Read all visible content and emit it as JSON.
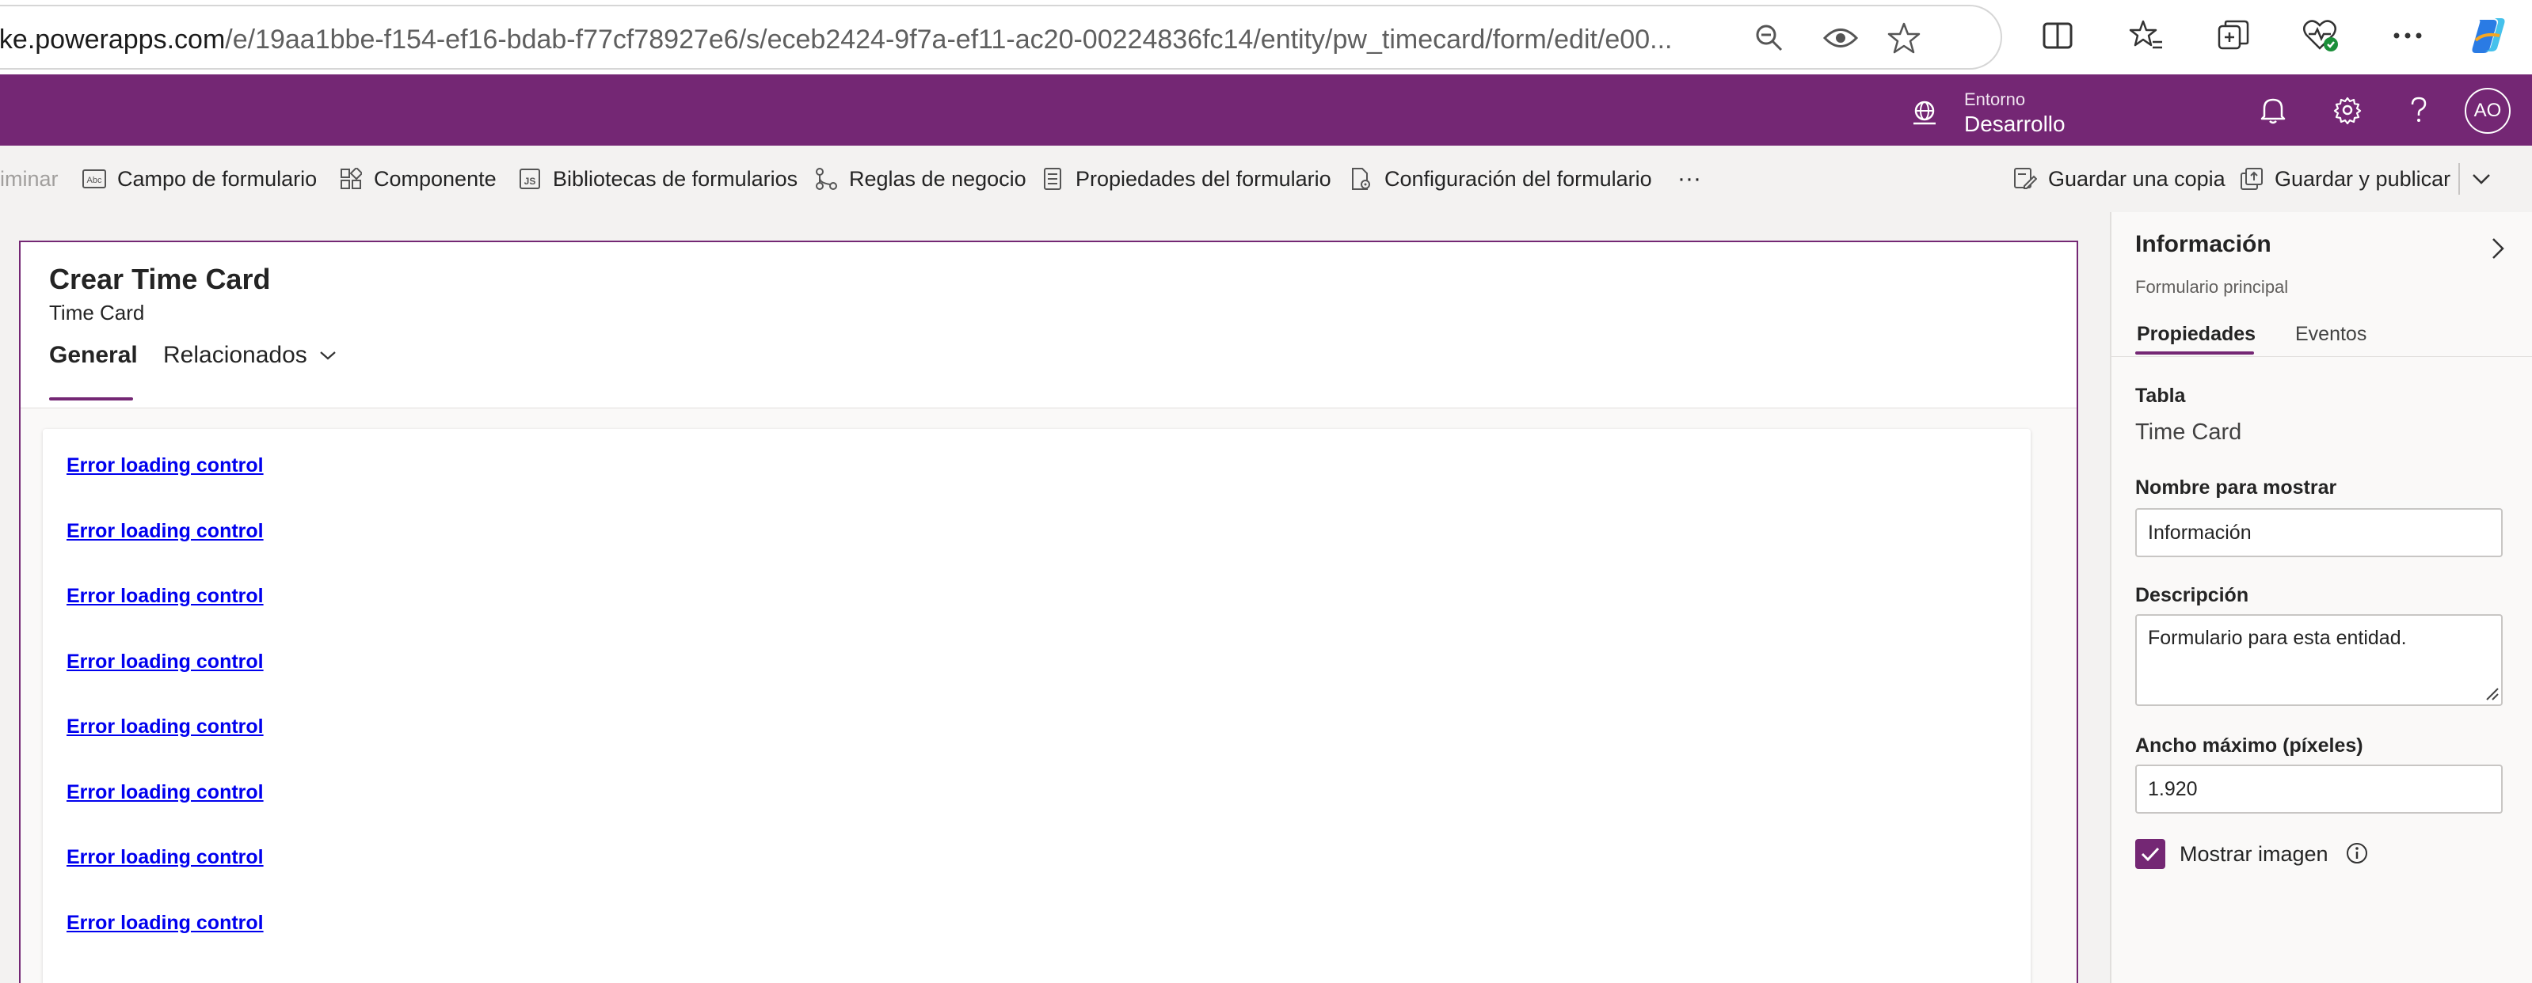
{
  "browser": {
    "url_host": "ake.powerapps.com",
    "url_path": "/e/19aa1bbe-f154-ef16-bdab-f77cf78927e6/s/eceb2424-9f7a-ef11-ac20-00224836fc14/entity/pw_timecard/form/edit/e00...",
    "icons": [
      "zoom-out-icon",
      "eye-icon",
      "star-icon",
      "split-screen-icon",
      "favorites-icon",
      "collections-icon",
      "browser-essentials-icon",
      "more-icon",
      "copilot-icon"
    ]
  },
  "header": {
    "environment_label": "Entorno",
    "environment_value": "Desarrollo",
    "avatar_initials": "AO",
    "brand_color": "#742774"
  },
  "commandbar": {
    "delete_label": "liminar",
    "form_field_label": "Campo de formulario",
    "component_label": "Componente",
    "form_libraries_label": "Bibliotecas de formularios",
    "business_rules_label": "Reglas de negocio",
    "form_properties_label": "Propiedades del formulario",
    "form_settings_label": "Configuración del formulario",
    "more_label": "···",
    "save_copy_label": "Guardar una copia",
    "save_publish_label": "Guardar y publicar"
  },
  "form": {
    "title": "Crear Time Card",
    "subtitle": "Time Card",
    "tabs": [
      {
        "label": "General",
        "active": true
      },
      {
        "label": "Relacionados",
        "active": false
      }
    ],
    "error_links": [
      "Error loading control",
      "Error loading control",
      "Error loading control",
      "Error loading control",
      "Error loading control",
      "Error loading control",
      "Error loading control",
      "Error loading control"
    ]
  },
  "panel": {
    "title": "Información",
    "subtitle": "Formulario principal",
    "tabs": [
      {
        "label": "Propiedades",
        "active": true
      },
      {
        "label": "Eventos",
        "active": false
      }
    ],
    "table_label": "Tabla",
    "table_value": "Time Card",
    "display_name_label": "Nombre para mostrar",
    "display_name_value": "Información",
    "description_label": "Descripción",
    "description_value": "Formulario para esta entidad.",
    "max_width_label": "Ancho máximo (píxeles)",
    "max_width_value": "1.920",
    "show_image_label": "Mostrar imagen",
    "show_image_checked": true
  }
}
